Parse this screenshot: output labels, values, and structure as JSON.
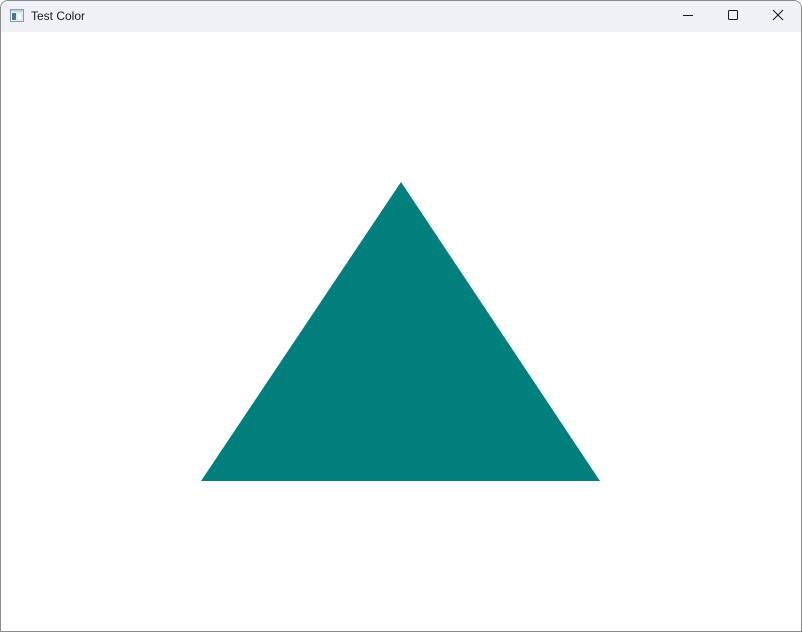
{
  "window": {
    "title": "Test Color",
    "icons": {
      "app": "app-window-icon",
      "minimize": "minimize-icon",
      "maximize": "maximize-icon",
      "close": "close-icon"
    }
  },
  "canvas": {
    "background": "#ffffff",
    "shape": {
      "type": "triangle",
      "fill": "#017f7d"
    }
  }
}
